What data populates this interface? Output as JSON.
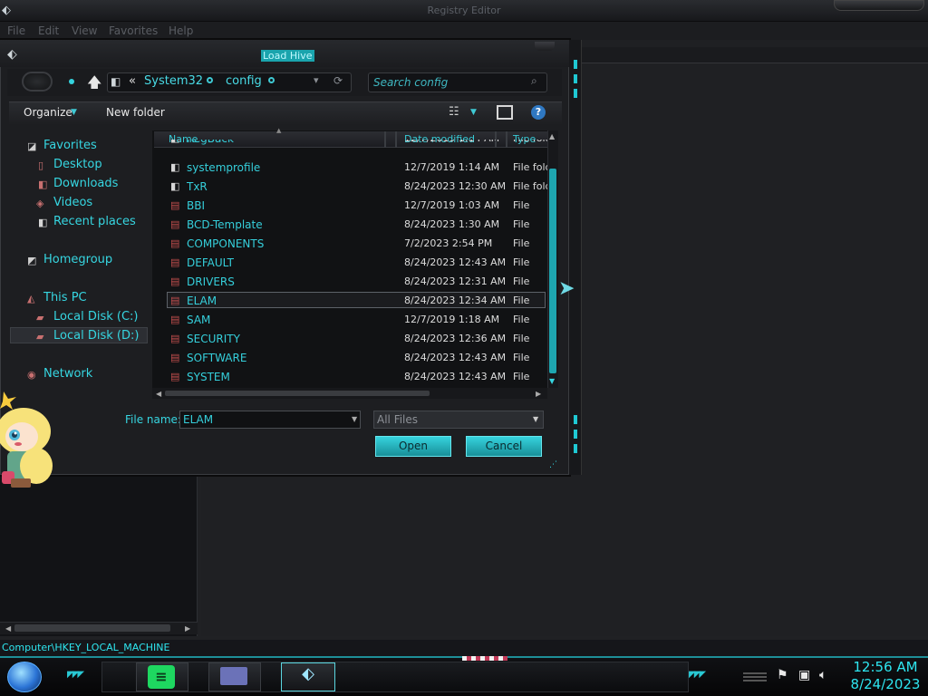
{
  "regedit": {
    "title": "Registry Editor",
    "menu": [
      "File",
      "Edit",
      "View",
      "Favorites",
      "Help"
    ],
    "status": "Computer\\HKEY_LOCAL_MACHINE"
  },
  "dialog": {
    "title": "Load Hive",
    "breadcrumb": [
      "System32",
      "config"
    ],
    "breadcrumb_prefix": "«",
    "search_placeholder": "Search config",
    "toolbar": {
      "organize": "Organize",
      "new_folder": "New folder"
    },
    "nav": {
      "favorites": "Favorites",
      "desktop": "Desktop",
      "downloads": "Downloads",
      "videos": "Videos",
      "recent": "Recent places",
      "homegroup": "Homegroup",
      "this_pc": "This PC",
      "disk_c": "Local Disk (C:)",
      "disk_d": "Local Disk (D:)",
      "network": "Network"
    },
    "columns": {
      "name": "Name",
      "date": "Date modified",
      "type": "Type"
    },
    "files": [
      {
        "name": "RegBack",
        "date": "12/7/2019 1:14 AM",
        "type": "File folder",
        "kind": "folder"
      },
      {
        "name": "systemprofile",
        "date": "12/7/2019 1:14 AM",
        "type": "File folder",
        "kind": "folder"
      },
      {
        "name": "TxR",
        "date": "8/24/2023 12:30 AM",
        "type": "File folder",
        "kind": "folder"
      },
      {
        "name": "BBI",
        "date": "12/7/2019 1:03 AM",
        "type": "File",
        "kind": "file"
      },
      {
        "name": "BCD-Template",
        "date": "8/24/2023 1:30 AM",
        "type": "File",
        "kind": "file"
      },
      {
        "name": "COMPONENTS",
        "date": "7/2/2023 2:54 PM",
        "type": "File",
        "kind": "file"
      },
      {
        "name": "DEFAULT",
        "date": "8/24/2023 12:43 AM",
        "type": "File",
        "kind": "file"
      },
      {
        "name": "DRIVERS",
        "date": "8/24/2023 12:31 AM",
        "type": "File",
        "kind": "file"
      },
      {
        "name": "ELAM",
        "date": "8/24/2023 12:34 AM",
        "type": "File",
        "kind": "file"
      },
      {
        "name": "SAM",
        "date": "12/7/2019 1:18 AM",
        "type": "File",
        "kind": "file"
      },
      {
        "name": "SECURITY",
        "date": "8/24/2023 12:36 AM",
        "type": "File",
        "kind": "file"
      },
      {
        "name": "SOFTWARE",
        "date": "8/24/2023 12:43 AM",
        "type": "File",
        "kind": "file"
      },
      {
        "name": "SYSTEM",
        "date": "8/24/2023 12:43 AM",
        "type": "File",
        "kind": "file"
      }
    ],
    "file_name_label": "File name:",
    "file_name_value": "ELAM",
    "file_type_value": "All Files",
    "open_label": "Open",
    "cancel_label": "Cancel"
  },
  "taskbar": {
    "time": "12:56 AM",
    "date": "8/24/2023"
  },
  "colors": {
    "accent": "#2ee6f0",
    "background": "#1b1c1f"
  }
}
